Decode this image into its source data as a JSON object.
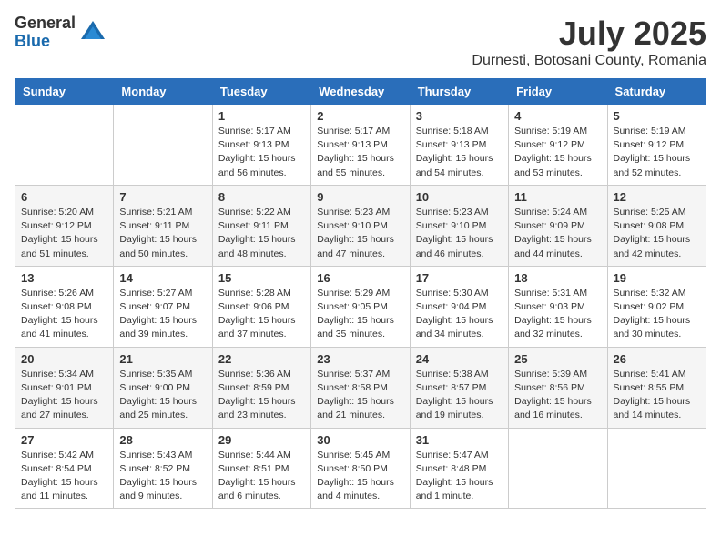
{
  "logo": {
    "general": "General",
    "blue": "Blue"
  },
  "title": "July 2025",
  "location": "Durnesti, Botosani County, Romania",
  "days_of_week": [
    "Sunday",
    "Monday",
    "Tuesday",
    "Wednesday",
    "Thursday",
    "Friday",
    "Saturday"
  ],
  "weeks": [
    [
      {
        "day": "",
        "info": ""
      },
      {
        "day": "",
        "info": ""
      },
      {
        "day": "1",
        "info": "Sunrise: 5:17 AM\nSunset: 9:13 PM\nDaylight: 15 hours\nand 56 minutes."
      },
      {
        "day": "2",
        "info": "Sunrise: 5:17 AM\nSunset: 9:13 PM\nDaylight: 15 hours\nand 55 minutes."
      },
      {
        "day": "3",
        "info": "Sunrise: 5:18 AM\nSunset: 9:13 PM\nDaylight: 15 hours\nand 54 minutes."
      },
      {
        "day": "4",
        "info": "Sunrise: 5:19 AM\nSunset: 9:12 PM\nDaylight: 15 hours\nand 53 minutes."
      },
      {
        "day": "5",
        "info": "Sunrise: 5:19 AM\nSunset: 9:12 PM\nDaylight: 15 hours\nand 52 minutes."
      }
    ],
    [
      {
        "day": "6",
        "info": "Sunrise: 5:20 AM\nSunset: 9:12 PM\nDaylight: 15 hours\nand 51 minutes."
      },
      {
        "day": "7",
        "info": "Sunrise: 5:21 AM\nSunset: 9:11 PM\nDaylight: 15 hours\nand 50 minutes."
      },
      {
        "day": "8",
        "info": "Sunrise: 5:22 AM\nSunset: 9:11 PM\nDaylight: 15 hours\nand 48 minutes."
      },
      {
        "day": "9",
        "info": "Sunrise: 5:23 AM\nSunset: 9:10 PM\nDaylight: 15 hours\nand 47 minutes."
      },
      {
        "day": "10",
        "info": "Sunrise: 5:23 AM\nSunset: 9:10 PM\nDaylight: 15 hours\nand 46 minutes."
      },
      {
        "day": "11",
        "info": "Sunrise: 5:24 AM\nSunset: 9:09 PM\nDaylight: 15 hours\nand 44 minutes."
      },
      {
        "day": "12",
        "info": "Sunrise: 5:25 AM\nSunset: 9:08 PM\nDaylight: 15 hours\nand 42 minutes."
      }
    ],
    [
      {
        "day": "13",
        "info": "Sunrise: 5:26 AM\nSunset: 9:08 PM\nDaylight: 15 hours\nand 41 minutes."
      },
      {
        "day": "14",
        "info": "Sunrise: 5:27 AM\nSunset: 9:07 PM\nDaylight: 15 hours\nand 39 minutes."
      },
      {
        "day": "15",
        "info": "Sunrise: 5:28 AM\nSunset: 9:06 PM\nDaylight: 15 hours\nand 37 minutes."
      },
      {
        "day": "16",
        "info": "Sunrise: 5:29 AM\nSunset: 9:05 PM\nDaylight: 15 hours\nand 35 minutes."
      },
      {
        "day": "17",
        "info": "Sunrise: 5:30 AM\nSunset: 9:04 PM\nDaylight: 15 hours\nand 34 minutes."
      },
      {
        "day": "18",
        "info": "Sunrise: 5:31 AM\nSunset: 9:03 PM\nDaylight: 15 hours\nand 32 minutes."
      },
      {
        "day": "19",
        "info": "Sunrise: 5:32 AM\nSunset: 9:02 PM\nDaylight: 15 hours\nand 30 minutes."
      }
    ],
    [
      {
        "day": "20",
        "info": "Sunrise: 5:34 AM\nSunset: 9:01 PM\nDaylight: 15 hours\nand 27 minutes."
      },
      {
        "day": "21",
        "info": "Sunrise: 5:35 AM\nSunset: 9:00 PM\nDaylight: 15 hours\nand 25 minutes."
      },
      {
        "day": "22",
        "info": "Sunrise: 5:36 AM\nSunset: 8:59 PM\nDaylight: 15 hours\nand 23 minutes."
      },
      {
        "day": "23",
        "info": "Sunrise: 5:37 AM\nSunset: 8:58 PM\nDaylight: 15 hours\nand 21 minutes."
      },
      {
        "day": "24",
        "info": "Sunrise: 5:38 AM\nSunset: 8:57 PM\nDaylight: 15 hours\nand 19 minutes."
      },
      {
        "day": "25",
        "info": "Sunrise: 5:39 AM\nSunset: 8:56 PM\nDaylight: 15 hours\nand 16 minutes."
      },
      {
        "day": "26",
        "info": "Sunrise: 5:41 AM\nSunset: 8:55 PM\nDaylight: 15 hours\nand 14 minutes."
      }
    ],
    [
      {
        "day": "27",
        "info": "Sunrise: 5:42 AM\nSunset: 8:54 PM\nDaylight: 15 hours\nand 11 minutes."
      },
      {
        "day": "28",
        "info": "Sunrise: 5:43 AM\nSunset: 8:52 PM\nDaylight: 15 hours\nand 9 minutes."
      },
      {
        "day": "29",
        "info": "Sunrise: 5:44 AM\nSunset: 8:51 PM\nDaylight: 15 hours\nand 6 minutes."
      },
      {
        "day": "30",
        "info": "Sunrise: 5:45 AM\nSunset: 8:50 PM\nDaylight: 15 hours\nand 4 minutes."
      },
      {
        "day": "31",
        "info": "Sunrise: 5:47 AM\nSunset: 8:48 PM\nDaylight: 15 hours\nand 1 minute."
      },
      {
        "day": "",
        "info": ""
      },
      {
        "day": "",
        "info": ""
      }
    ]
  ]
}
